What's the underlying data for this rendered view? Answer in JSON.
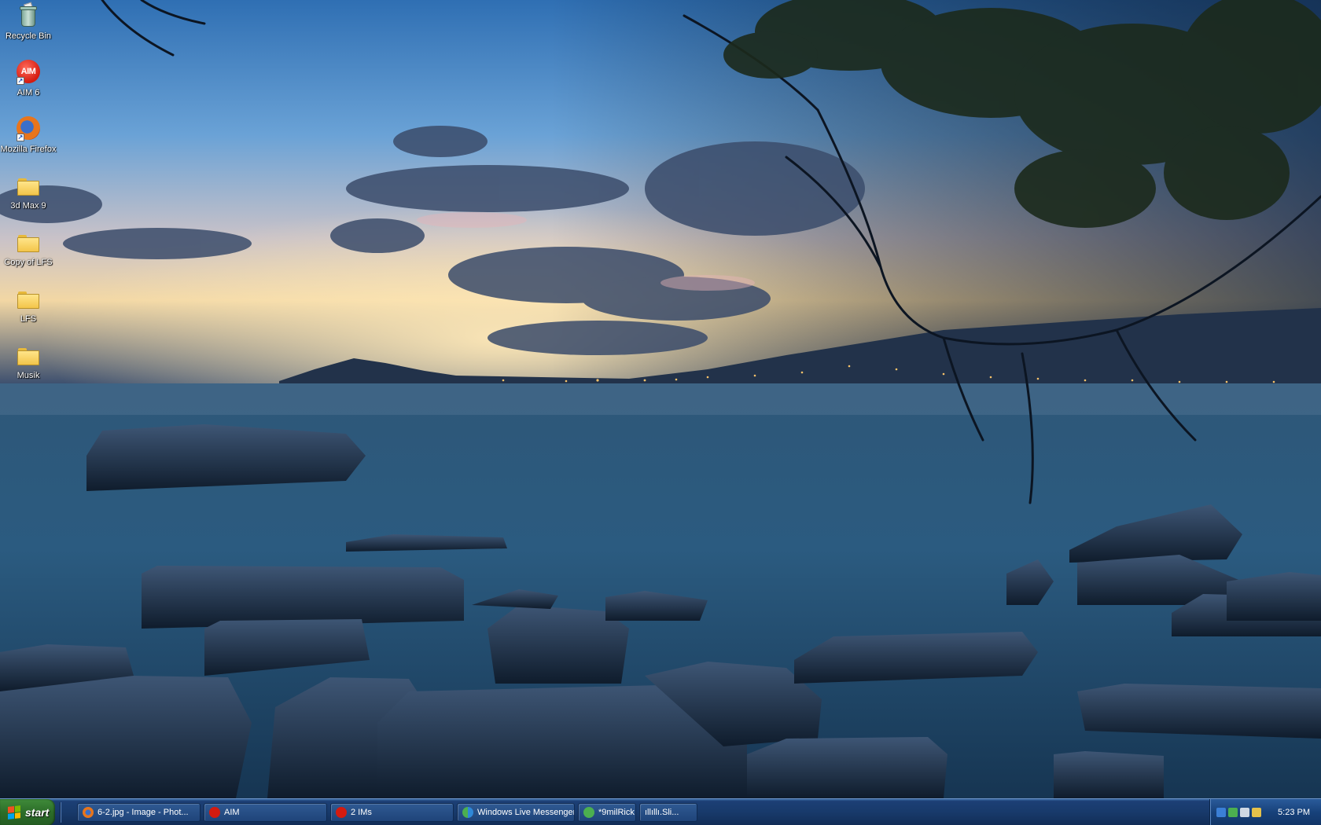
{
  "desktop": {
    "icons": [
      {
        "label": "Recycle Bin",
        "icon": "recycle-bin-icon"
      },
      {
        "label": "AIM 6",
        "icon": "aim-icon",
        "logo_text": "AIM"
      },
      {
        "label": "Mozilla Firefox",
        "icon": "firefox-icon"
      },
      {
        "label": "3d Max 9",
        "icon": "folder-icon"
      },
      {
        "label": "Copy of LFS",
        "icon": "folder-icon"
      },
      {
        "label": "LFS",
        "icon": "folder-icon"
      },
      {
        "label": "Musik",
        "icon": "folder-icon"
      }
    ],
    "wallpaper": "sunset seascape with rocks and tree branches"
  },
  "taskbar": {
    "start_label": "start",
    "tasks": [
      {
        "label": "6-2.jpg - Image - Phot...",
        "icon": "firefox-icon"
      },
      {
        "label": "AIM",
        "icon": "aim-icon"
      },
      {
        "label": "2 IMs",
        "icon": "aim-icon"
      },
      {
        "label": "Windows Live Messenger",
        "icon": "messenger-icon"
      },
      {
        "label": "*9milRick",
        "icon": "messenger-icon"
      },
      {
        "label": "ıllıllı.Sli...",
        "icon": ""
      }
    ],
    "clock": "5:23 PM"
  },
  "colors": {
    "taskbar": "#1c3f75",
    "start_button": "#2c6d29"
  }
}
